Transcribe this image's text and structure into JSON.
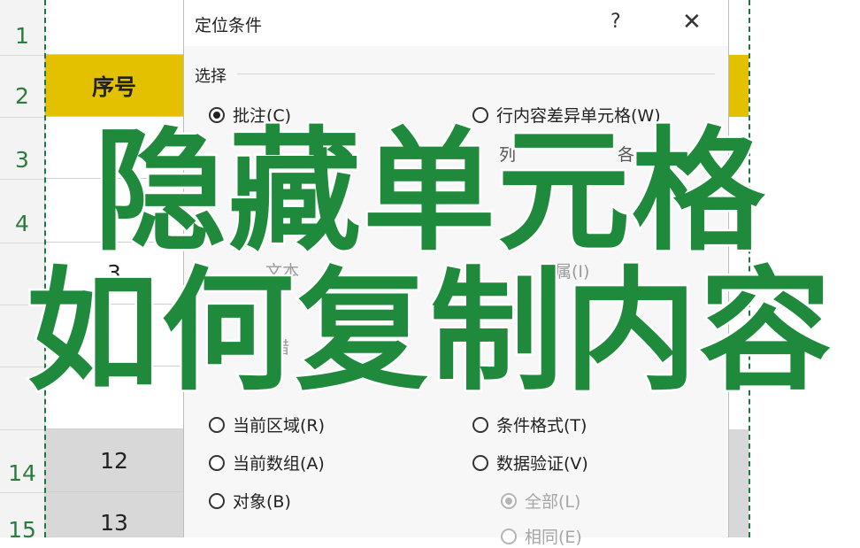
{
  "spreadsheet": {
    "row_numbers": [
      "1",
      "2",
      "3",
      "4",
      "14",
      "15"
    ],
    "header_cell": "序号",
    "cells": [
      "3",
      "12",
      "13"
    ]
  },
  "dialog": {
    "title": "定位条件",
    "help_label": "?",
    "close_label": "✕",
    "section_label": "选择",
    "options_left": [
      {
        "label": "批注(C)",
        "selected": true
      },
      {
        "label": "当前区域(R)",
        "selected": false
      },
      {
        "label": "当前数组(A)",
        "selected": false
      },
      {
        "label": "对象(B)",
        "selected": false
      }
    ],
    "options_right": [
      {
        "label": "行内容差异单元格(W)",
        "selected": false
      },
      {
        "label": "条件格式(T)",
        "selected": false
      },
      {
        "label": "数据验证(V)",
        "selected": false
      }
    ],
    "sub_options": [
      {
        "label": "全部(L)",
        "selected": true
      },
      {
        "label": "相同(E)",
        "selected": false
      }
    ],
    "fragments": [
      "列",
      "各",
      "首属(I)",
      "文本",
      "错"
    ]
  },
  "overlay": {
    "line1": "隐藏单元格",
    "line2": "如何复制内容",
    "color": "#1f8a3c"
  },
  "colors": {
    "header_yellow": "#e3c000",
    "row_number_green": "#2a7d3c",
    "selection_dash": "#217346"
  }
}
